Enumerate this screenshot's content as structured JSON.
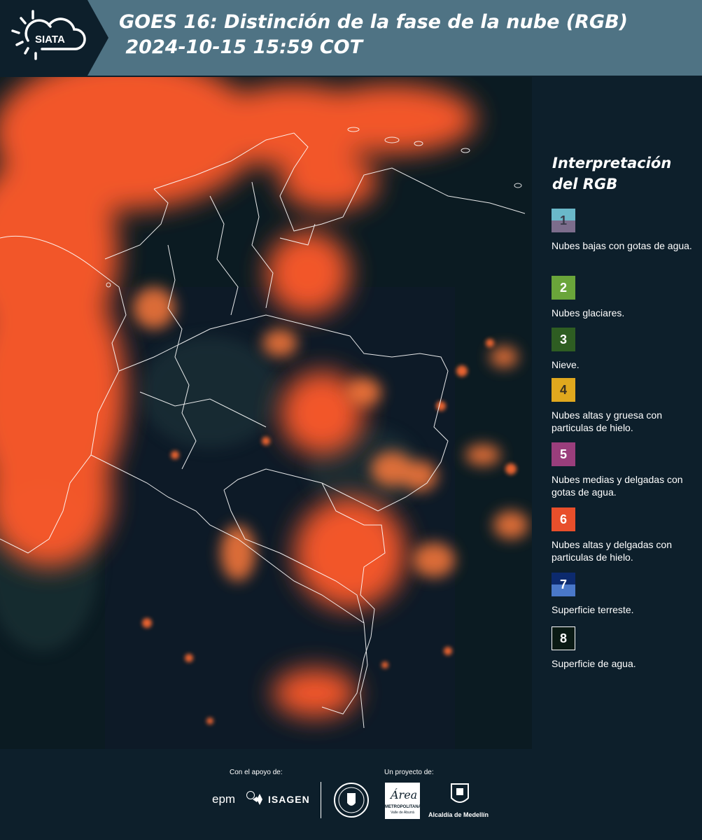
{
  "header": {
    "logo_text": "SIATA",
    "title": "GOES 16: Distinción de la fase de la nube (RGB)\n 2024-10-15 15:59 COT"
  },
  "map": {
    "icon": "satellite-map-image"
  },
  "legend": {
    "title": "Interpretación del RGB",
    "items": [
      {
        "number": "1",
        "label": "Nubes bajas con gotas de agua.",
        "colors": [
          "#6ab8c9",
          "#7c6d8c"
        ]
      },
      {
        "number": "2",
        "label": "Nubes glaciares.",
        "colors": [
          "#6aa53a"
        ]
      },
      {
        "number": "3",
        "label": "Nieve.",
        "colors": [
          "#2e5d22"
        ]
      },
      {
        "number": "4",
        "label": "Nubes altas y gruesa con particulas de hielo.",
        "colors": [
          "#e0a81e"
        ]
      },
      {
        "number": "5",
        "label": "Nubes medias y delgadas con gotas de agua.",
        "colors": [
          "#9a3e7c"
        ]
      },
      {
        "number": "6",
        "label": "Nubes altas y delgadas con particulas de hielo.",
        "colors": [
          "#e84f2b"
        ]
      },
      {
        "number": "7",
        "label": "Superficie terreste.",
        "colors": [
          "#0c2a6e",
          "#4a78c9"
        ]
      },
      {
        "number": "8",
        "label": "Superficie de agua.",
        "colors": [
          "#0a1a14"
        ]
      }
    ]
  },
  "footer": {
    "support_label": "Con el apoyo de:",
    "project_label": "Un proyecto de:",
    "brand_epm": "epm",
    "brand_isagen": "ISAGEN",
    "area_logo_text": "Área",
    "area_subtext": "METROPOLITANA",
    "area_subtext2": "Valle de Aburrá",
    "alcaldia_text": "Alcaldía de Medellín"
  },
  "colors": {
    "header_bg": "#4f7384",
    "logo_bg": "#0d1f2b",
    "page_bg": "#0d1f2b",
    "cloud_orange": "#ff5a2a"
  }
}
